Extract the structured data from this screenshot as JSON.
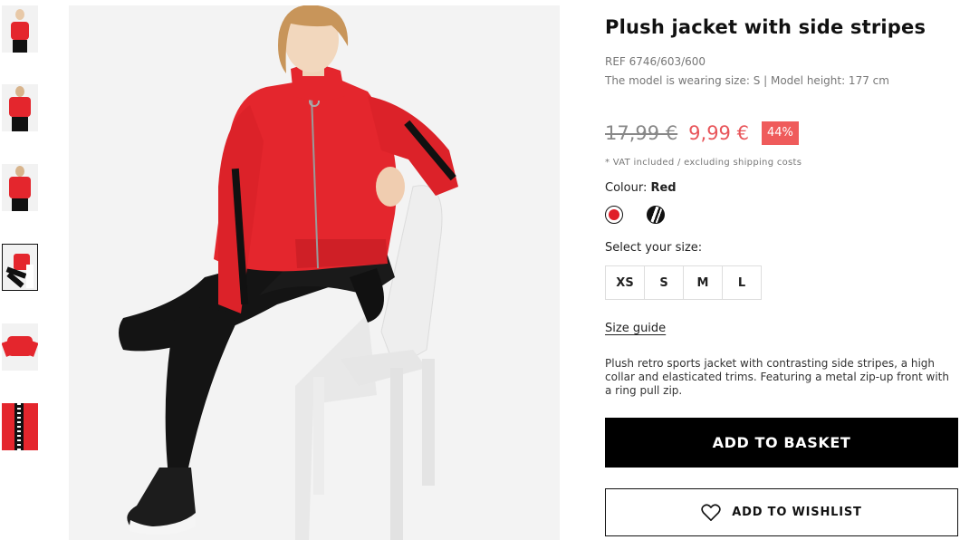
{
  "product": {
    "title": "Plush jacket with side stripes",
    "ref": "REF 6746/603/600",
    "model_info": "The model is wearing size: S | Model height: 177 cm",
    "old_price": "17,99 €",
    "new_price": "9,99 €",
    "discount": "44%",
    "vat_note": "* VAT included / excluding shipping costs",
    "colour_label": "Colour:",
    "colour_value": "Red",
    "colours": [
      {
        "name": "Red",
        "hex": "#e01e29",
        "icon": "red-swatch"
      },
      {
        "name": "Black/white",
        "hex": "#111111",
        "icon": "striped-swatch"
      }
    ],
    "size_label": "Select your size:",
    "sizes": [
      "XS",
      "S",
      "M",
      "L"
    ],
    "size_guide": "Size guide",
    "description": "Plush retro sports jacket with contrasting side stripes, a high collar and elasticated trims. Featuring a metal zip-up front with a ring pull zip.",
    "add_to_basket": "ADD TO BASKET",
    "add_to_wishlist": "ADD TO WISHLIST"
  },
  "colors": {
    "accent_red": "#e8555a",
    "discount_bg": "#ef5b5b",
    "jacket_red": "#e4262d",
    "button_black": "#000000"
  },
  "gallery": {
    "thumbnail_count": 6,
    "active_index": 3
  }
}
